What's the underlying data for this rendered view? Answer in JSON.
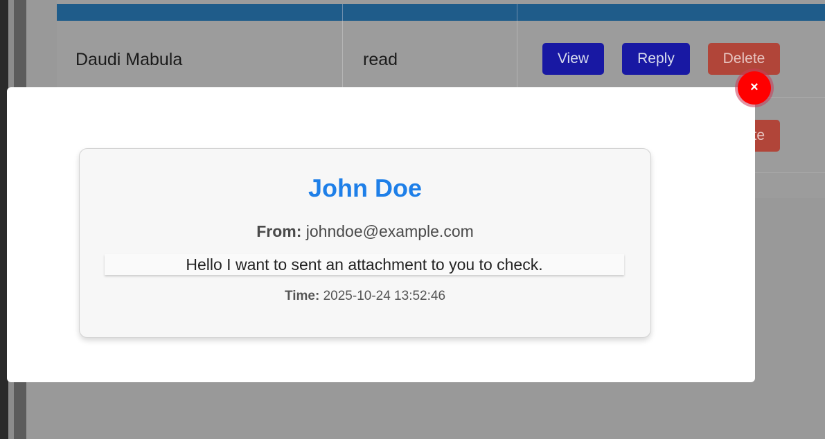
{
  "table": {
    "rows": [
      {
        "name": "Daudi Mabula",
        "status": "read"
      }
    ],
    "actions": {
      "view_label": "View",
      "reply_label": "Reply",
      "delete_label": "Delete",
      "delete_partial_label": "te"
    }
  },
  "modal": {
    "close_label": "×",
    "message": {
      "name": "John Doe",
      "from_label": "From:",
      "from_value": "johndoe@example.com",
      "body": "Hello I want to sent an attachment to you to check.",
      "time_label": "Time:",
      "time_value": "2025-10-24 13:52:46"
    }
  },
  "colors": {
    "header": "#1f5c8a",
    "primary_button": "#1818a3",
    "danger_button": "#b14539",
    "name_accent": "#1e7fe8",
    "close_button": "#ff0000"
  }
}
